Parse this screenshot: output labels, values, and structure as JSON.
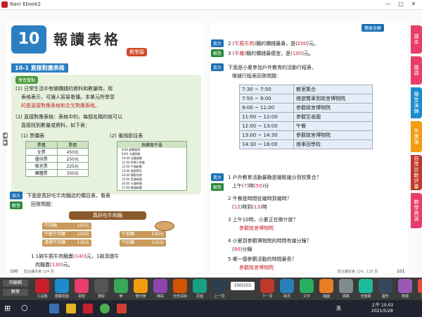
{
  "app": {
    "title": "Nani Ebook2",
    "min": "—",
    "max": "□",
    "close": "✕"
  },
  "header": {
    "chapter_no": "10",
    "chapter_title": "報讀表格",
    "chapter_sub": "數學篇",
    "full_answer": "題頁全解"
  },
  "left": {
    "section": "10-1 直接對應表格",
    "key_points": "學習重點",
    "p1a": "(1) 日常生活中有關價錢的資料和數量時，用",
    "p1b": "表格表示，可讓人容易看懂。本單元所學習",
    "p1c": "的是直接對應表格和交叉對應表格。",
    "p2a": "(2) 直接對應表格：表格中的，每個名稱的就可以",
    "p2b": "直接找到數量或資料，如下表：",
    "tbl1_title": "(1) 票價表",
    "tbl1_head": [
      "票種",
      "票價"
    ],
    "tbl1_rows": [
      [
        "全票",
        "450元"
      ],
      [
        "優待票",
        "250元"
      ],
      [
        "敬老票",
        "225元"
      ],
      [
        "團體票",
        "350元"
      ]
    ],
    "tbl2_title": "(2) 電視節目表",
    "tbl2_head": "快樂親子臺",
    "tbl2_rows": [
      "8:00 新聞報導",
      "9:00 卡通時間",
      "10:00 兒童劇場",
      "11:00 科學小常識",
      "12:00 午間新聞",
      "13:00 旅遊節目",
      "14:00 電影欣賞",
      "15:00 音樂時間",
      "16:00 卡通時間",
      "17:00 晚間新聞"
    ],
    "q_badge": "放大",
    "q_badge2": "解答",
    "q1": "下面是真好吃牛肉麵店的價目表，看表",
    "q1b": "回答問題：",
    "menu_title": "真好吃牛肉麵",
    "menu": [
      [
        "牛肉麵",
        "100元"
      ],
      [
        "牛筋牛肉麵",
        "200元"
      ],
      [
        "清燉牛肉麵",
        "130元"
      ],
      [
        "牛筋麵",
        "140元"
      ],
      [
        "牛肚麵",
        "120元"
      ]
    ],
    "a1a": "1 1碗牛筋牛肉麵賣(",
    "a1v": "140",
    "a1b": ")元，1碗清燉牛",
    "a1c": "肉麵賣(",
    "a1v2": "130",
    "a1d": ")元。",
    "page_no": "100",
    "footer": "配合課本第 124 頁"
  },
  "right": {
    "r2a": "2 (",
    "r2v": "牛筋牛肉",
    "r2b": ")麵的價錢最貴，是(",
    "r2v2": "200",
    "r2c": ")元。",
    "r3a": "3 (",
    "r3v": "牛雜",
    "r3b": ")麵的價錢最便宜，是(",
    "r3v2": "100",
    "r3c": ")元。",
    "q2": "下面是小夏參加戶外教育的活動行程表，",
    "q2b": "根據行程表回答問題：",
    "sched": [
      [
        "7:30 ~ 7:50",
        "教室集合"
      ],
      [
        "7:50 ~ 9:00",
        "搭遊覽車到故宮博物院"
      ],
      [
        "9:00 ~ 11:00",
        "參觀故宮博物院"
      ],
      [
        "11:00 ~ 12:00",
        "參觀至善園"
      ],
      [
        "12:00 ~ 13:00",
        "午餐"
      ],
      [
        "13:00 ~ 14:30",
        "參觀故宮博物院"
      ],
      [
        "14:30 ~ 16:00",
        "搭車回學校"
      ]
    ],
    "s1": "1 戶外教育活動最晚是幾點幾分到校集合？",
    "s1b": "上午(",
    "s1v": "7",
    "s1c": ")時(",
    "s1v2": "50",
    "s1d": ")分",
    "s2": "2 午餐是時間從幾時到幾時？",
    "s2a": "(",
    "s2v": "12",
    "s2b": ")時到(",
    "s2v2": "13",
    "s2c": ")時",
    "s3": "3 上午10時，小夏正在做什麼？",
    "s3v": "參觀故宮博物院",
    "s4": "4 小夏到參觀博物院的時間有幾分鐘？",
    "s4a": "(",
    "s4v": "90",
    "s4b": ")分鐘",
    "s5": "5 哪一個參觀活動的時間最長？",
    "s5v": "參觀故宮博物院",
    "page_no": "101",
    "footer": "配合課本第 124、125 頁"
  },
  "tabs": [
    "課本",
    "國語",
    "隨堂演練",
    "作業簿",
    "自學診斷評量",
    "教學資源"
  ],
  "tab_colors": [
    "#e83e6c",
    "#e83e6c",
    "#1c8ccf",
    "#f39c12",
    "#c0392b",
    "#e83e6c"
  ],
  "toolbar": {
    "left1": "回編輯",
    "left2": "數學",
    "labels": [
      "工具箱",
      "隱藏視窗",
      "視窗",
      "選取",
      "筆",
      "螢光筆",
      "擦拭",
      "全部清除",
      "頁面",
      "上一頁",
      "下一頁",
      "跳頁",
      "文字",
      "縮圖",
      "網路",
      "全螢幕",
      "圖形",
      "軟體",
      "離開"
    ],
    "page": "100/101"
  },
  "taskbar": {
    "search": "○",
    "time": "上午 10:03",
    "date": "2021/5/28",
    "lang": "英"
  }
}
